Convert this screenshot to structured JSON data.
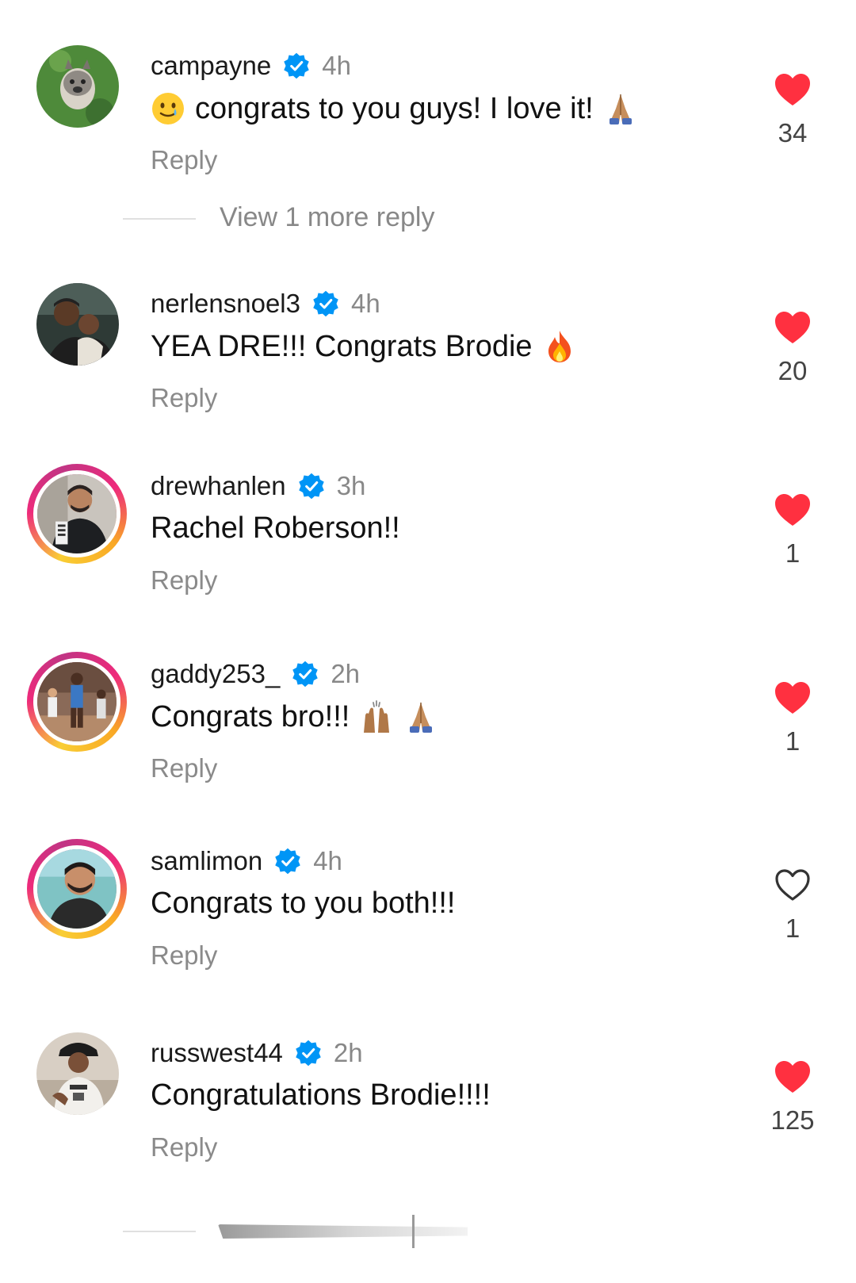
{
  "comments": [
    {
      "username": "campayne",
      "time": "4h",
      "text": "congrats to you guys! I love it!",
      "reply_label": "Reply",
      "likes": "34",
      "liked": true
    },
    {
      "username": "nerlensnoel3",
      "time": "4h",
      "text": "YEA DRE!!! Congrats Brodie",
      "reply_label": "Reply",
      "likes": "20",
      "liked": true
    },
    {
      "username": "drewhanlen",
      "time": "3h",
      "text": "Rachel Roberson!!",
      "reply_label": "Reply",
      "likes": "1",
      "liked": true
    },
    {
      "username": "gaddy253_",
      "time": "2h",
      "text": "Congrats bro!!!",
      "reply_label": "Reply",
      "likes": "1",
      "liked": true
    },
    {
      "username": "samlimon",
      "time": "4h",
      "text": "Congrats to you both!!!",
      "reply_label": "Reply",
      "likes": "1",
      "liked": false
    },
    {
      "username": "russwest44",
      "time": "2h",
      "text": "Congratulations Brodie!!!!",
      "reply_label": "Reply",
      "likes": "125",
      "liked": true
    }
  ],
  "view_more": {
    "label": "View 1 more reply"
  },
  "colors": {
    "heart_filled": "#ff3040",
    "verified": "#0095f6",
    "secondary_text": "#888888"
  },
  "icons": {
    "verified": "verified-badge-icon",
    "like_filled": "heart-filled-icon",
    "like_outline": "heart-outline-icon"
  }
}
